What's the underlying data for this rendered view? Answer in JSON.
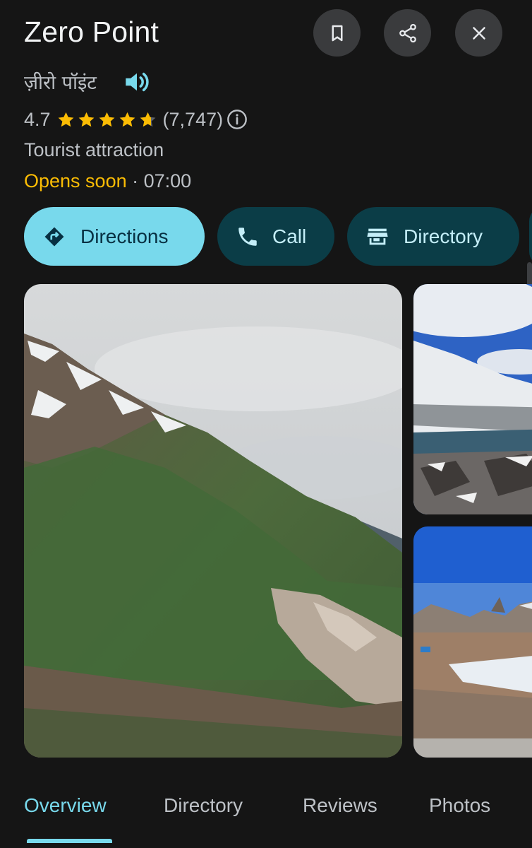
{
  "place": {
    "name": "Zero Point",
    "local_name": "ज़ीरो पॉइंट",
    "rating": "4.7",
    "stars": 4.7,
    "reviews_count": "(7,747)",
    "category": "Tourist attraction",
    "status": "Opens soon",
    "separator": " · ",
    "time": "07:00"
  },
  "actions": {
    "directions": "Directions",
    "call": "Call",
    "directory": "Directory"
  },
  "tabs": [
    {
      "label": "Overview",
      "active": true
    },
    {
      "label": "Directory",
      "active": false
    },
    {
      "label": "Reviews",
      "active": false
    },
    {
      "label": "Photos",
      "active": false
    }
  ],
  "icons": {
    "save": "bookmark-icon",
    "share": "share-icon",
    "close": "close-icon",
    "pronounce": "speaker-icon",
    "info": "info-icon"
  },
  "colors": {
    "accent": "#78d9ec",
    "tonal_button": "#0b3d47",
    "star": "#fbbc04",
    "status_opens": "#fbbc04",
    "background": "#151515"
  }
}
